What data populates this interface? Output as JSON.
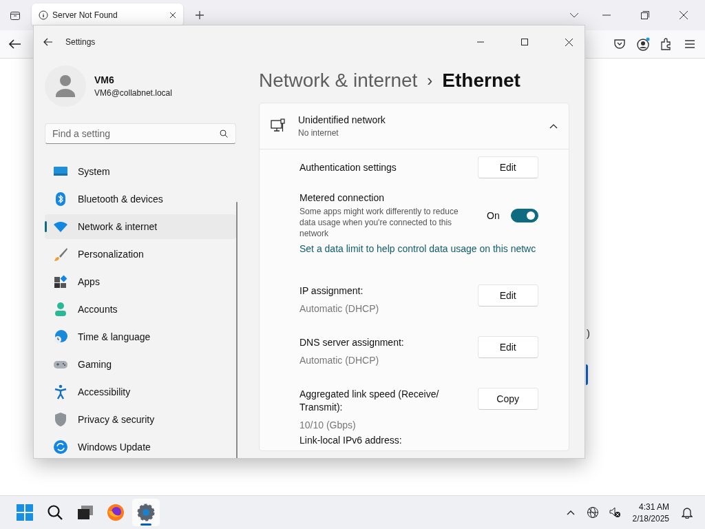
{
  "browser": {
    "tab": {
      "title": "Server Not Found"
    },
    "page_fragment": ")"
  },
  "settings": {
    "title": "Settings",
    "user": {
      "name": "VM6",
      "email": "VM6@collabnet.local"
    },
    "search": {
      "placeholder": "Find a setting"
    },
    "nav": [
      {
        "label": "System",
        "selected": false
      },
      {
        "label": "Bluetooth & devices",
        "selected": false
      },
      {
        "label": "Network & internet",
        "selected": true
      },
      {
        "label": "Personalization",
        "selected": false
      },
      {
        "label": "Apps",
        "selected": false
      },
      {
        "label": "Accounts",
        "selected": false
      },
      {
        "label": "Time & language",
        "selected": false
      },
      {
        "label": "Gaming",
        "selected": false
      },
      {
        "label": "Accessibility",
        "selected": false
      },
      {
        "label": "Privacy & security",
        "selected": false
      },
      {
        "label": "Windows Update",
        "selected": false
      }
    ],
    "breadcrumb": {
      "parent": "Network & internet",
      "separator": "›",
      "current": "Ethernet"
    },
    "network": {
      "name": "Unidentified network",
      "status": "No internet",
      "expanded": true
    },
    "rows": [
      {
        "kind": "action",
        "label": "Authentication settings",
        "button": "Edit"
      },
      {
        "kind": "toggle",
        "label": "Metered connection",
        "description": "Some apps might work differently to reduce data usage when you're connected to this network",
        "state_text": "On",
        "on": true
      },
      {
        "kind": "link",
        "text": "Set a data limit to help control data usage on this netwc"
      },
      {
        "kind": "property",
        "label": "IP assignment:",
        "value": "Automatic (DHCP)",
        "button": "Edit"
      },
      {
        "kind": "property",
        "label": "DNS server assignment:",
        "value": "Automatic (DHCP)",
        "button": "Edit"
      },
      {
        "kind": "property",
        "label": "Aggregated link speed (Receive/ Transmit):",
        "value": "10/10 (Gbps)",
        "button": "Copy"
      },
      {
        "kind": "property",
        "label": "Link-local IPv6 address:"
      }
    ]
  },
  "taskbar": {
    "apps": [
      {
        "selected": false
      },
      {
        "selected": false
      },
      {
        "selected": false
      },
      {
        "selected": false
      },
      {
        "selected": true
      }
    ],
    "time": "4:31 AM",
    "date": "2/18/2025"
  }
}
